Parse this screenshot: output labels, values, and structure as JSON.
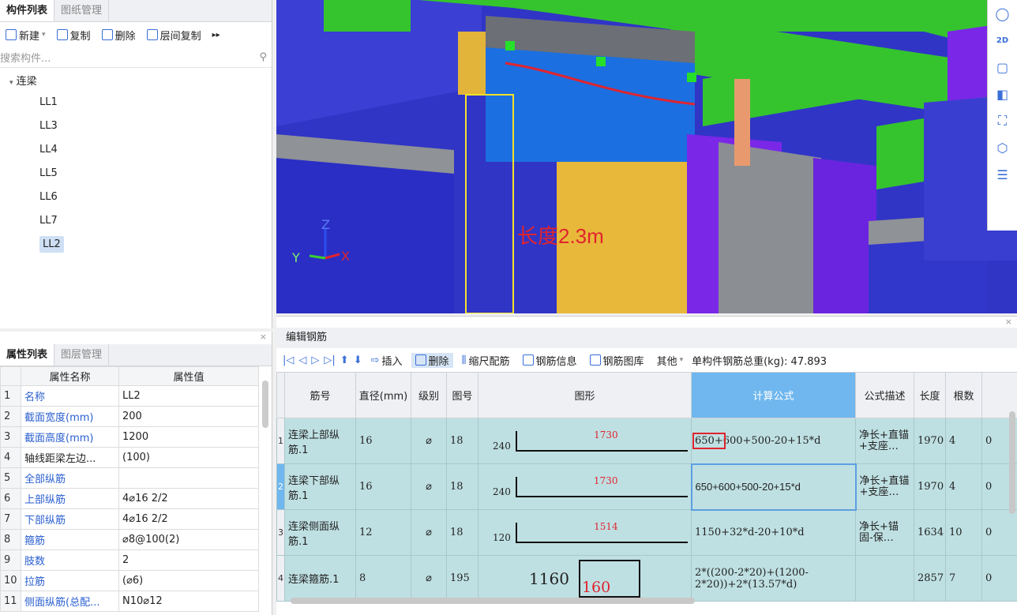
{
  "left_top": {
    "tabs": [
      "构件列表",
      "图纸管理"
    ],
    "toolbar": {
      "new": "新建",
      "copy": "复制",
      "delete": "删除",
      "floor_copy": "层间复制"
    },
    "search_placeholder": "搜索构件...",
    "tree_root": "连梁",
    "items": [
      "LL1",
      "LL3",
      "LL4",
      "LL5",
      "LL6",
      "LL7",
      "LL2"
    ]
  },
  "left_bottom": {
    "tabs": [
      "属性列表",
      "图层管理"
    ],
    "headers": [
      "属性名称",
      "属性值"
    ],
    "rows": [
      {
        "idx": "1",
        "name": "名称",
        "value": "LL2",
        "blue": true
      },
      {
        "idx": "2",
        "name": "截面宽度(mm)",
        "value": "200",
        "blue": true
      },
      {
        "idx": "3",
        "name": "截面高度(mm)",
        "value": "1200",
        "blue": true
      },
      {
        "idx": "4",
        "name": "轴线距梁左边...",
        "value": "(100)",
        "blue": false
      },
      {
        "idx": "5",
        "name": "全部纵筋",
        "value": "",
        "blue": true
      },
      {
        "idx": "6",
        "name": "上部纵筋",
        "value": "4⌀16 2/2",
        "blue": true
      },
      {
        "idx": "7",
        "name": "下部纵筋",
        "value": "4⌀16 2/2",
        "blue": true
      },
      {
        "idx": "8",
        "name": "箍筋",
        "value": "⌀8@100(2)",
        "blue": true
      },
      {
        "idx": "9",
        "name": "肢数",
        "value": "2",
        "blue": true
      },
      {
        "idx": "10",
        "name": "拉筋",
        "value": "(⌀6)",
        "blue": true
      },
      {
        "idx": "11",
        "name": "侧面纵筋(总配...",
        "value": "N10⌀12",
        "blue": true
      }
    ]
  },
  "viewport": {
    "annotation": "长度2.3m",
    "axis_x": "X",
    "axis_y": "Y",
    "axis_z": "Z"
  },
  "rebar": {
    "title": "编辑钢筋",
    "toolbar": {
      "insert": "插入",
      "delete": "删除",
      "scale": "缩尺配筋",
      "info": "钢筋信息",
      "library": "钢筋图库",
      "other": "其他",
      "total": "单构件钢筋总重(kg): 47.893"
    },
    "headers": [
      "筋号",
      "直径(mm)",
      "级别",
      "图号",
      "图形",
      "计算公式",
      "公式描述",
      "长度",
      "根数",
      ""
    ],
    "rows": [
      {
        "idx": "1",
        "name": "连梁上部纵筋.1",
        "dia": "16",
        "grade": "⌀",
        "fig": "18",
        "left": "240",
        "top": "1730",
        "formula": "650+600+500-20+15*d",
        "desc": "净长+直锚+支座…",
        "len": "1970",
        "count": "4",
        "last": "0"
      },
      {
        "idx": "2",
        "name": "连梁下部纵筋.1",
        "dia": "16",
        "grade": "⌀",
        "fig": "18",
        "left": "240",
        "top": "1730",
        "formula": "650+600+500-20+15*d",
        "desc": "净长+直锚+支座…",
        "len": "1970",
        "count": "4",
        "last": "0"
      },
      {
        "idx": "3",
        "name": "连梁侧面纵筋.1",
        "dia": "12",
        "grade": "⌀",
        "fig": "18",
        "left": "120",
        "top": "1514",
        "formula": "1150+32*d-20+10*d",
        "desc": "净长+锚固-保…",
        "len": "1634",
        "count": "10",
        "last": "0"
      },
      {
        "idx": "4",
        "name": "连梁箍筋.1",
        "dia": "8",
        "grade": "⌀",
        "fig": "195",
        "left": "1160",
        "top": "160",
        "formula": "2*((200-2*20)+(1200-2*20))+2*(13.57*d)",
        "desc": "",
        "len": "2857",
        "count": "7",
        "last": "0"
      }
    ]
  }
}
